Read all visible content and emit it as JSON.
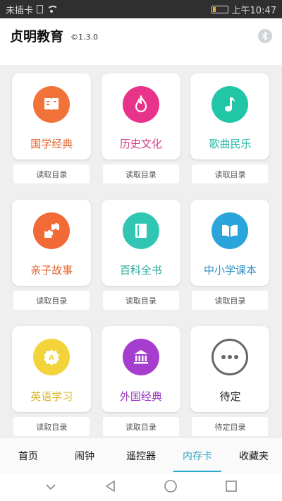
{
  "status_bar": {
    "carrier": "未插卡",
    "time": "上午10:47"
  },
  "header": {
    "title": "贞明教育",
    "version": "©1.3.0"
  },
  "colors": {
    "accent": "#2aa7c9"
  },
  "grid": [
    {
      "label": "国学经典",
      "button": "读取目录",
      "icon": "book-icon",
      "color": "#f2733a",
      "label_color": "#e0622e"
    },
    {
      "label": "历史文化",
      "button": "读取目录",
      "icon": "flame-icon",
      "color": "#e8338a",
      "label_color": "#d63a85"
    },
    {
      "label": "歌曲民乐",
      "button": "读取目录",
      "icon": "music-note-icon",
      "color": "#20c6a5",
      "label_color": "#27b8a6"
    },
    {
      "label": "亲子故事",
      "button": "读取目录",
      "icon": "puzzle-icon",
      "color": "#f26a35",
      "label_color": "#e2652f"
    },
    {
      "label": "百科全书",
      "button": "读取目录",
      "icon": "encyclopedia-icon",
      "color": "#31c6b3",
      "label_color": "#24a99c"
    },
    {
      "label": "中小学课本",
      "button": "读取目录",
      "icon": "open-book-icon",
      "color": "#2aa5dc",
      "label_color": "#2a8ec4"
    },
    {
      "label": "英语学习",
      "button": "读取目录",
      "icon": "english-badge-icon",
      "color": "#f2d43a",
      "label_color": "#d9b82a"
    },
    {
      "label": "外国经典",
      "button": "读取目录",
      "icon": "museum-icon",
      "color": "#a53ecf",
      "label_color": "#9a3cc0"
    },
    {
      "label": "待定",
      "button": "待定目录",
      "icon": "more-icon",
      "color": "#666666",
      "label_color": "#222222"
    }
  ],
  "nav": {
    "tabs": [
      "首页",
      "闹钟",
      "遥控器",
      "内存卡",
      "收藏夹"
    ],
    "active": "内存卡"
  }
}
